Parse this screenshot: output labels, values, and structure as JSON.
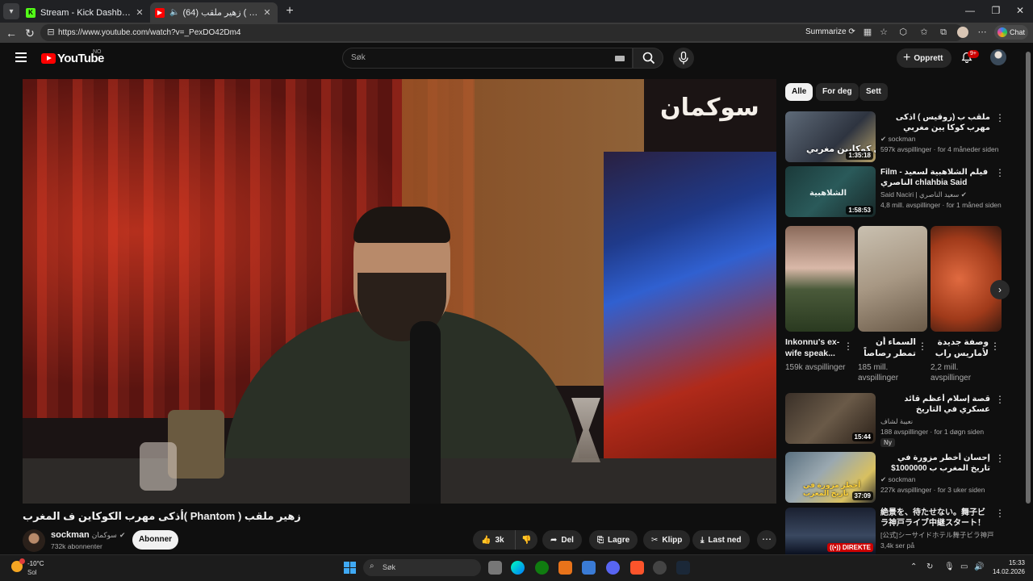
{
  "browser": {
    "tabs": [
      {
        "title": "Stream - Kick Dashboard",
        "favicon": "kick-icon",
        "color": "#53fc18"
      },
      {
        "title": "(64) زهير ملقب ( Phantom )أذ",
        "favicon": "youtube-icon",
        "color": "#ff0000"
      }
    ],
    "url": "https://www.youtube.com/watch?v=_PexDO42Dm4",
    "summarize_label": "Summarize",
    "chat_label": "Chat"
  },
  "header": {
    "logo_text": "YouTube",
    "region": "NO",
    "search_placeholder": "Søk",
    "create_label": "Opprett",
    "notification_count": "9+"
  },
  "video": {
    "watermark": "سوكمان",
    "title": "أذكى مهرب الكوكاين ف المغرب( Phantom ) زهير ملقب",
    "channel_name": "sockman",
    "channel_alt": "سوكمان",
    "subscribers": "732k abonnenter",
    "subscribe_label": "Abonner",
    "likes": "3k",
    "share_label": "Del",
    "save_label": "Lagre",
    "clip_label": "Klipp",
    "download_label": "Last ned"
  },
  "sidebar": {
    "chips": [
      "Alle",
      "For deg",
      "Sett"
    ],
    "recommended": [
      {
        "title": "ملقب ب (روقيس ) اذكى مهرب كوكا يين مغربي",
        "channel": "sockman",
        "meta": "597k avspillinger · for 4 måneder siden",
        "duration": "1:35:18",
        "thumb_text": "أذكى كوكايين مغربي"
      },
      {
        "title": "Film - فيلم الشلاهبية لسعيد الناصري chlahbia Said Naciri",
        "channel": "Said Naciri | سعيد الناصري",
        "meta": "4,8 mill. avspillinger · for 1 måned siden",
        "duration": "1:58:53",
        "thumb_text": "الشلاهبية"
      }
    ],
    "shorts": [
      {
        "title": "Inkonnu's ex-wife speak...",
        "views": "159k avspillinger"
      },
      {
        "title": "السماء أن تمطر رصاصاً !!",
        "views": "185 mill. avspillinger"
      },
      {
        "title": "وصفة جديدة لأماريس راب ...",
        "views": "2,2 mill. avspillinger"
      }
    ],
    "more": [
      {
        "title": "قصة إسلام أعظم قائد عسكري في التاريخ الإسلامي | خالد بن الوليد |",
        "channel": "نعيبة لشاف",
        "meta": "188 avspillinger · for 1 døgn siden",
        "duration": "15:44",
        "badge": "Ny"
      },
      {
        "title": "إحسان أخطر مزورة في تاريخ المغرب ب 1000000$",
        "channel": "sockman",
        "meta": "227k avspillinger · for 3 uker siden",
        "duration": "37:09",
        "thumb_text": "أخطر مزورة في تاريخ المغرب"
      },
      {
        "title": "絶景を、待たせない。舞子ビラ神戸ライブ中継スタート！明...",
        "channel": "[公式]シーサイドホテル舞子ビラ神戸",
        "meta": "3,4k ser på",
        "live": "DIREKTE"
      }
    ]
  },
  "taskbar": {
    "temperature": "-10°C",
    "condition": "Sol",
    "search_placeholder": "Søk",
    "time": "15:33",
    "date": "14.02.2026"
  }
}
